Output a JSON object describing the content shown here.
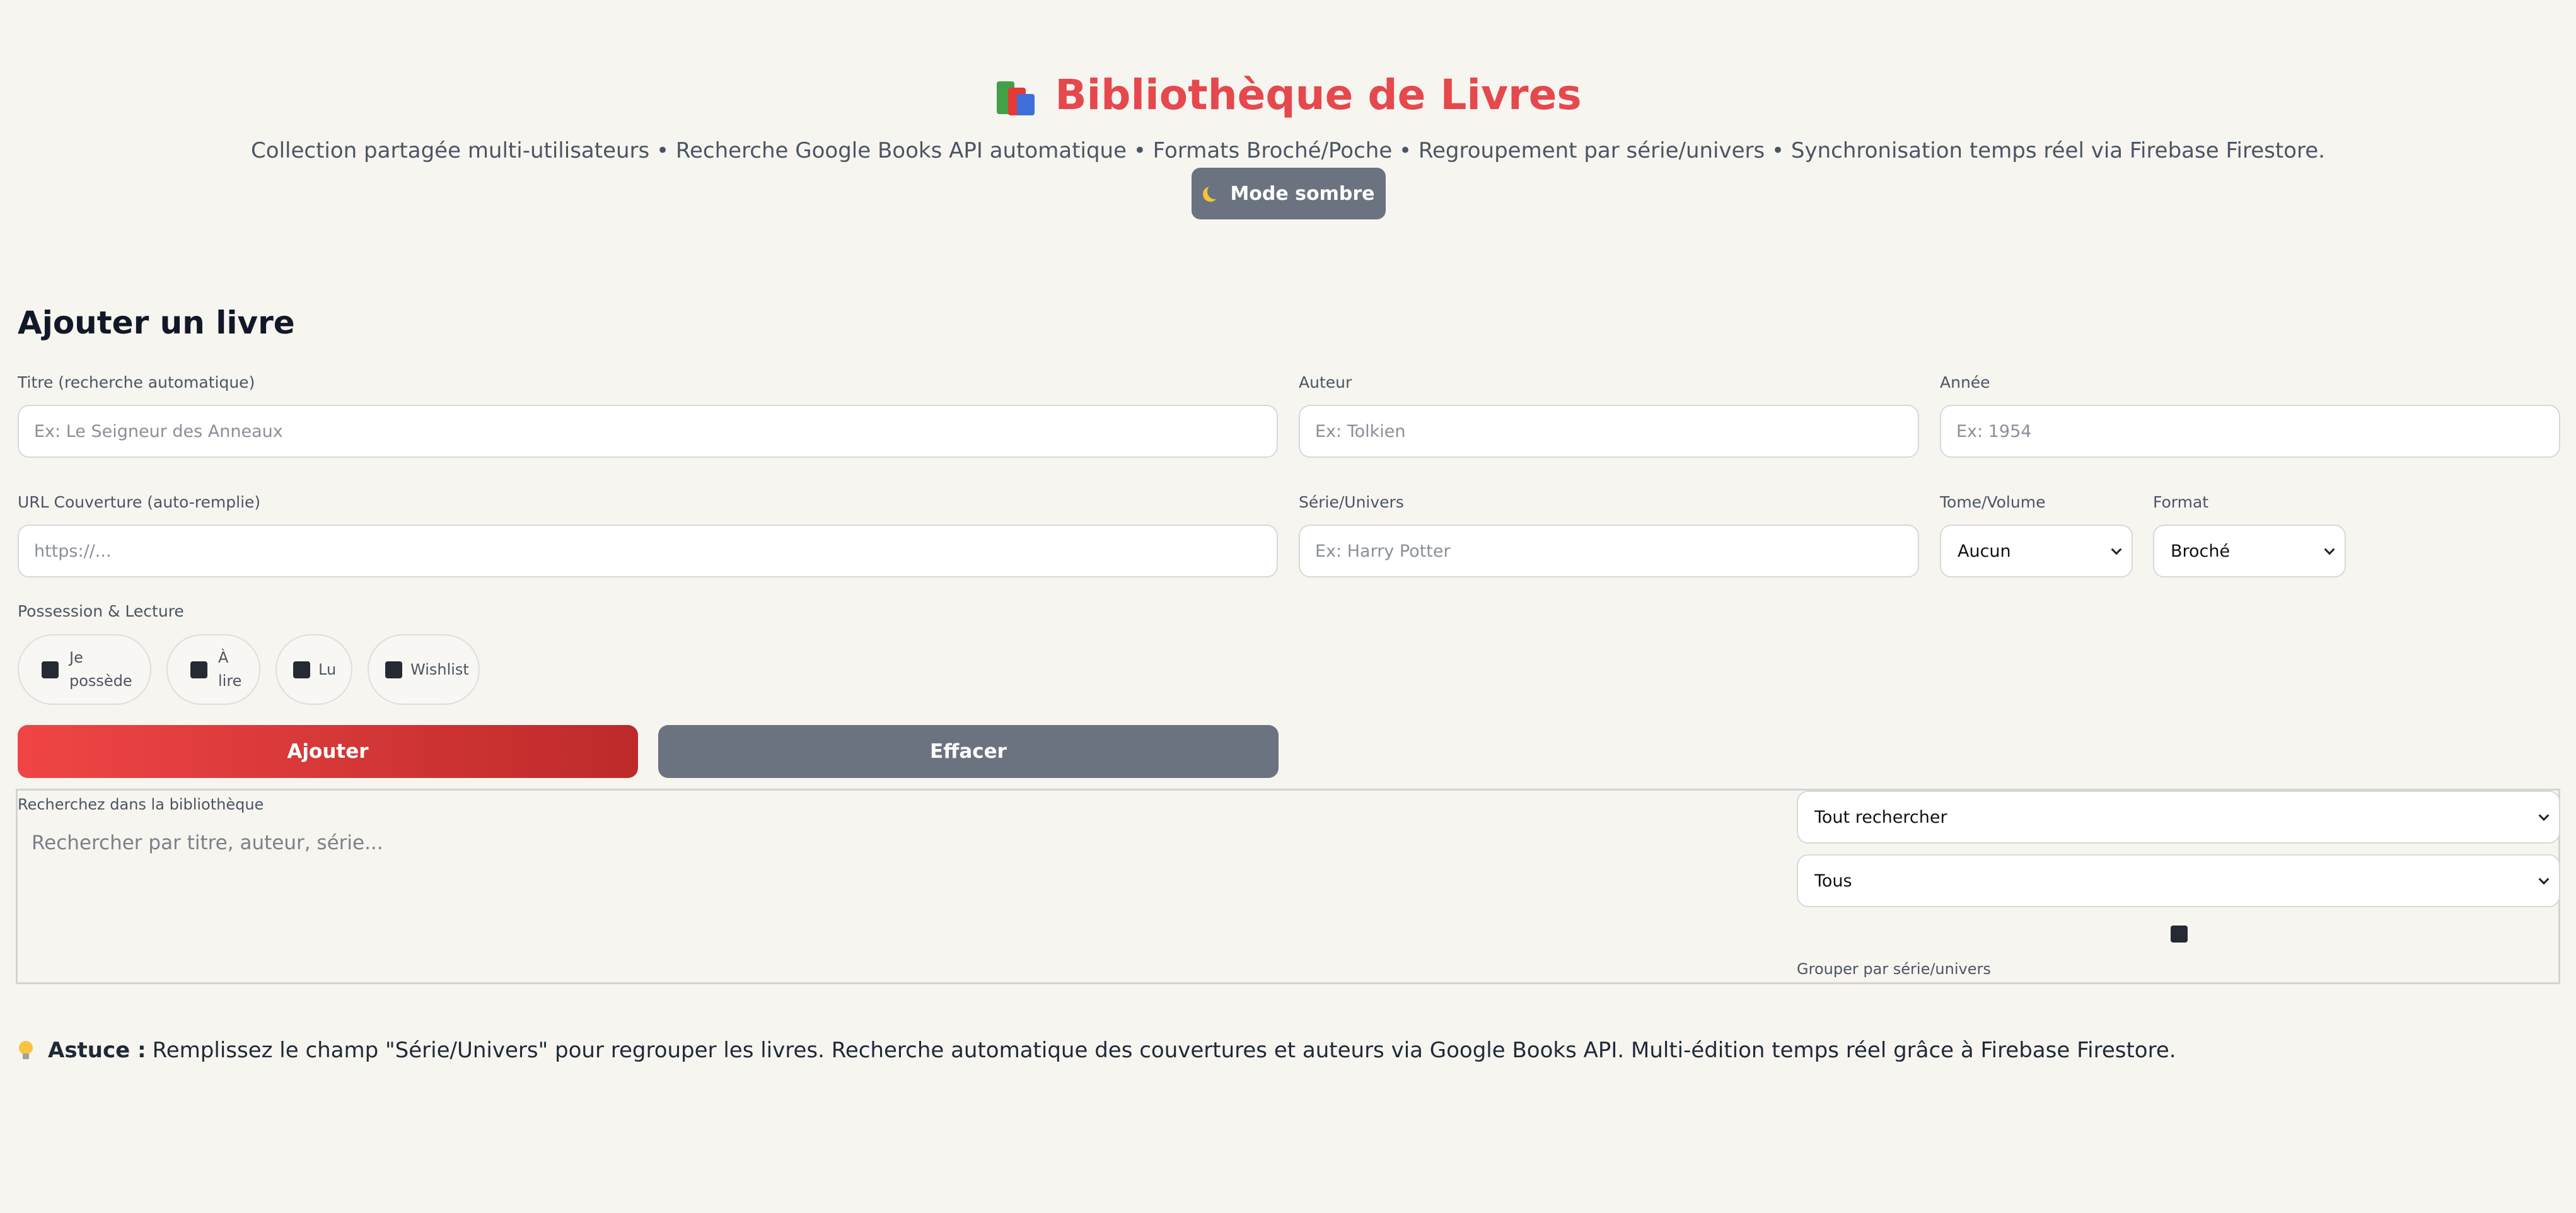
{
  "header": {
    "title": "Bibliothèque de Livres",
    "icon": "books-icon",
    "subtitle": "Collection partagée multi-utilisateurs • Recherche Google Books API automatique • Formats Broché/Poche • Regroupement par série/univers • Synchronisation temps réel via Firebase Firestore.",
    "dark_mode_label": "Mode sombre"
  },
  "form": {
    "heading": "Ajouter un livre",
    "title_label": "Titre (recherche automatique)",
    "title_placeholder": "Ex: Le Seigneur des Anneaux",
    "author_label": "Auteur",
    "author_placeholder": "Ex: Tolkien",
    "year_label": "Année",
    "year_placeholder": "Ex: 1954",
    "cover_label": "URL Couverture (auto-remplie)",
    "cover_placeholder": "https://...",
    "series_label": "Série/Univers",
    "series_placeholder": "Ex: Harry Potter",
    "volume_label": "Tome/Volume",
    "volume_value": "Aucun",
    "format_label": "Format",
    "format_value": "Broché",
    "possession_label": "Possession & Lecture",
    "checkboxes": {
      "owned_line1": "Je",
      "owned_line2": "possède",
      "to_read_line1": "À",
      "to_read_line2": "lire",
      "read": "Lu",
      "wishlist": "Wishlist"
    },
    "add_button": "Ajouter",
    "clear_button": "Effacer"
  },
  "search": {
    "label": "Recherchez dans la bibliothèque",
    "placeholder": "Rechercher par titre, auteur, série...",
    "scope_value": "Tout rechercher",
    "filter_value": "Tous",
    "group_label": "Grouper par série/univers"
  },
  "tip": {
    "prefix": "Astuce :",
    "text": "Remplissez le champ \"Série/Univers\" pour regrouper les livres. Recherche automatique des couvertures et auteurs via Google Books API. Multi-édition temps réel grâce à Firebase Firestore."
  },
  "colors": {
    "accent": "#e5484d",
    "secondary": "#6b7280",
    "background": "#f7f5f0"
  }
}
